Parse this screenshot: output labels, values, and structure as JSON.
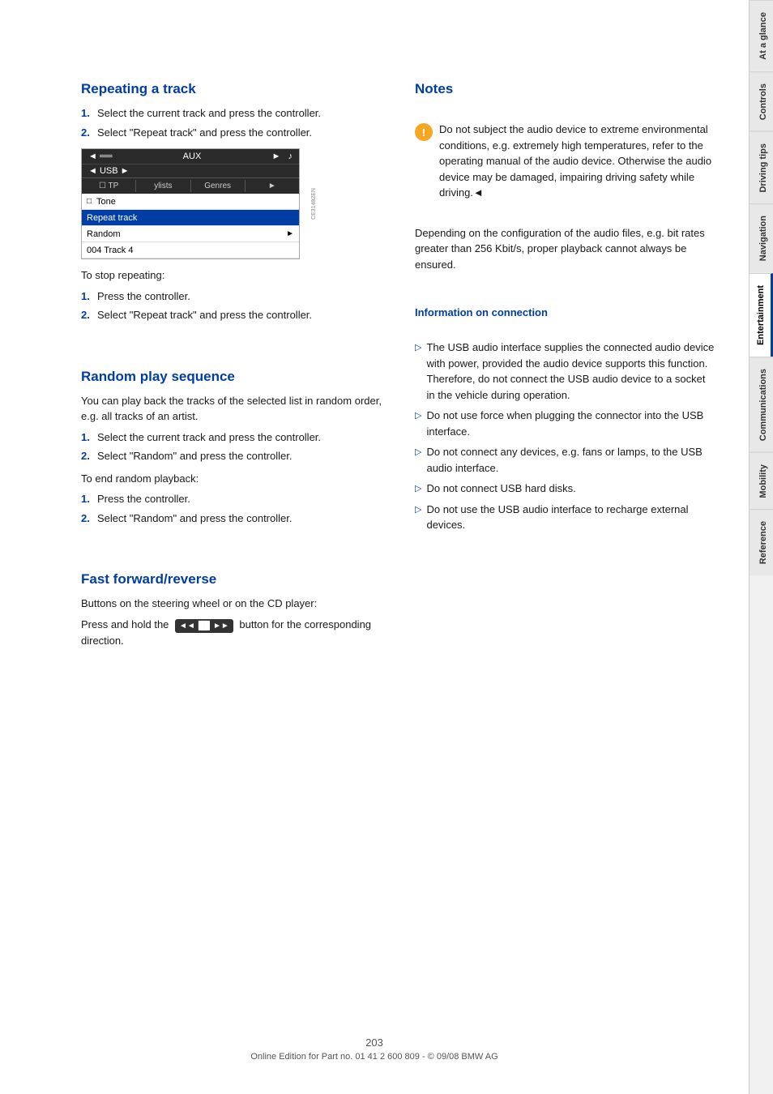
{
  "sidebar": {
    "tabs": [
      {
        "id": "at-a-glance",
        "label": "At a glance",
        "active": false
      },
      {
        "id": "controls",
        "label": "Controls",
        "active": false
      },
      {
        "id": "driving-tips",
        "label": "Driving tips",
        "active": false
      },
      {
        "id": "navigation",
        "label": "Navigation",
        "active": false
      },
      {
        "id": "entertainment",
        "label": "Entertainment",
        "active": true
      },
      {
        "id": "communications",
        "label": "Communications",
        "active": false
      },
      {
        "id": "mobility",
        "label": "Mobility",
        "active": false
      },
      {
        "id": "reference",
        "label": "Reference",
        "active": false
      }
    ]
  },
  "left_column": {
    "repeating_track": {
      "title": "Repeating a track",
      "steps": [
        "Select the current track and press the controller.",
        "Select \"Repeat track\" and press the controller."
      ],
      "screen": {
        "top_bar": "◄ ═══ AUX ►",
        "top_bar_icon": "♪",
        "second_bar": "◄ USB ►",
        "menu_items": [
          "TP",
          "ylists",
          "Genres",
          "►"
        ],
        "rows": [
          {
            "label": "Tone",
            "icon": "□",
            "highlighted": false
          },
          {
            "label": "Repeat track",
            "highlighted": true
          },
          {
            "label": "Random",
            "highlighted": false,
            "arrow": "►"
          },
          {
            "label": "004 Track 4",
            "highlighted": false
          }
        ]
      },
      "to_stop_label": "To stop repeating:",
      "stop_steps": [
        "Press the controller.",
        "Select \"Repeat track\" and press the controller."
      ]
    },
    "random_play": {
      "title": "Random play sequence",
      "intro": "You can play back the tracks of the selected list in random order, e.g. all tracks of an artist.",
      "steps": [
        "Select the current track and press the controller.",
        "Select \"Random\" and press the controller."
      ],
      "to_end_label": "To end random playback:",
      "end_steps": [
        "Press the controller.",
        "Select \"Random\" and press the controller."
      ]
    },
    "fast_forward": {
      "title": "Fast forward/reverse",
      "line1": "Buttons on the steering wheel or on the CD player:",
      "line2_prefix": "Press and hold the",
      "button_label": "◄◄  ►►",
      "line2_suffix": "button for the corresponding direction."
    }
  },
  "right_column": {
    "notes": {
      "title": "Notes",
      "warning_icon": "!",
      "warning_text": "Do not subject the audio device to extreme environmental conditions, e.g. extremely high temperatures, refer to the operating manual of the audio device. Otherwise the audio device may be damaged, impairing driving safety while driving.◄",
      "extra_note": "Depending on the configuration of the audio files, e.g. bit rates greater than 256 Kbit/s, proper playback cannot always be ensured.",
      "info_connection_title": "Information on connection",
      "bullets": [
        "The USB audio interface supplies the connected audio device with power, provided the audio device supports this function. Therefore, do not connect the USB audio device to a socket in the vehicle during operation.",
        "Do not use force when plugging the connector into the USB interface.",
        "Do not connect any devices, e.g. fans or lamps, to the USB audio interface.",
        "Do not connect USB hard disks.",
        "Do not use the USB audio interface to recharge external devices."
      ]
    }
  },
  "footer": {
    "page_number": "203",
    "copyright": "Online Edition for Part no. 01 41 2 600 809 - © 09/08 BMW AG"
  }
}
